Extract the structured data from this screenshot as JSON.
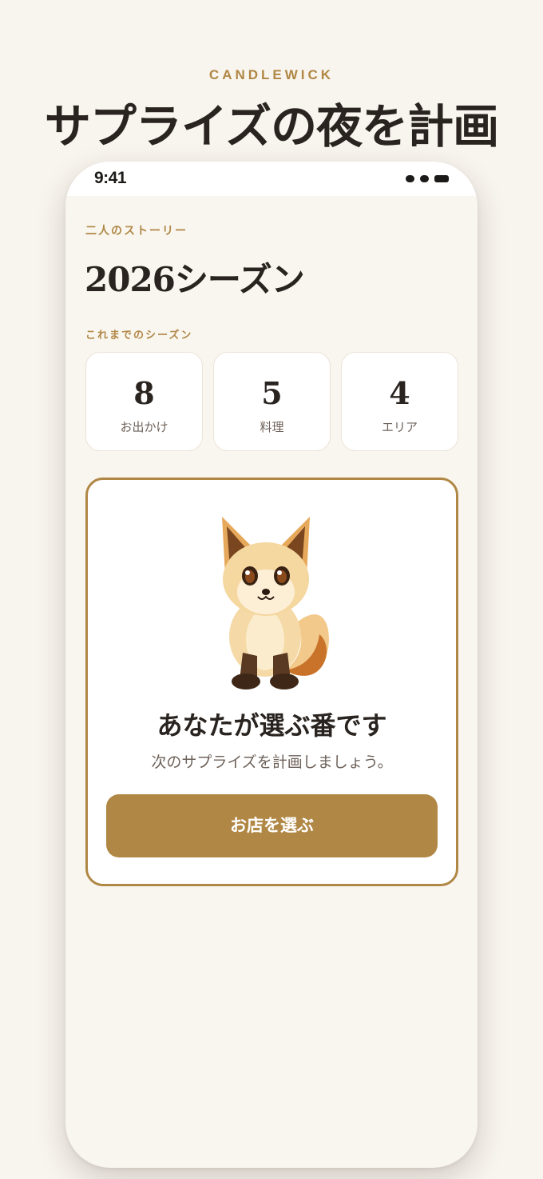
{
  "header": {
    "brand": "CANDLEWICK",
    "title": "サプライズの夜を計画"
  },
  "status_bar": {
    "time": "9:41"
  },
  "story": {
    "kicker": "二人のストーリー",
    "season_title": "2026シーズン",
    "section_label": "これまでのシーズン",
    "stats": [
      {
        "value": "8",
        "label": "お出かけ"
      },
      {
        "value": "5",
        "label": "料理"
      },
      {
        "value": "4",
        "label": "エリア"
      }
    ]
  },
  "turn_card": {
    "illustration": "fox-mascot-icon",
    "title": "あなたが選ぶ番です",
    "subtitle": "次のサプライズを計画しましょう。",
    "button_label": "お店を選ぶ"
  },
  "colors": {
    "accent": "#b08744",
    "background": "#f8f4ee",
    "text": "#2a2420",
    "muted": "#6e625a"
  }
}
